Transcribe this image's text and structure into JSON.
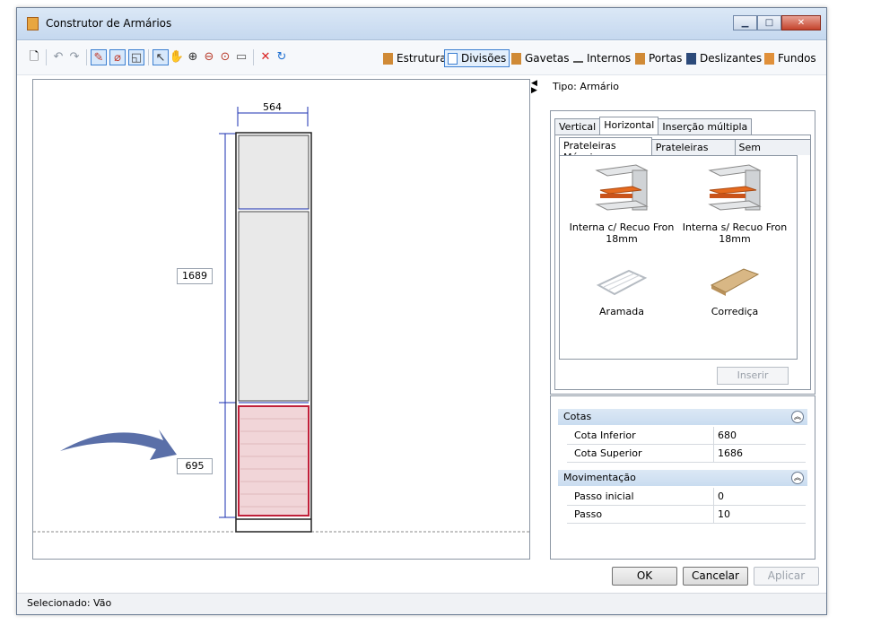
{
  "window": {
    "title": "Construtor de Armários",
    "minimize": "▁",
    "maximize": "□",
    "close": "✕"
  },
  "toolbar": {
    "left_icons": [
      "new-icon",
      "undo-icon",
      "redo-icon",
      "draw-icon",
      "edit-icon",
      "shape-icon",
      "select-icon",
      "pan-icon",
      "zoom-in-icon",
      "zoom-out-icon",
      "zoom-fit-icon",
      "window-icon",
      "delete-icon",
      "refresh-icon"
    ],
    "tabs": [
      {
        "label": "Estrutura",
        "icon": "estrutura-icon",
        "color": "#d08a36"
      },
      {
        "label": "Divisões",
        "icon": "divisoes-icon",
        "color": "#3c7fd1",
        "active": true
      },
      {
        "label": "Gavetas",
        "icon": "gavetas-icon",
        "color": "#d08a36"
      },
      {
        "label": "Internos",
        "icon": "internos-icon",
        "color": "#555555"
      },
      {
        "label": "Portas",
        "icon": "portas-icon",
        "color": "#d08a36"
      },
      {
        "label": "Deslizantes",
        "icon": "deslizantes-icon",
        "color": "#2c4a7a"
      },
      {
        "label": "Fundos",
        "icon": "fundos-icon",
        "color": "#e0903a"
      }
    ]
  },
  "drawing": {
    "width_label": "564",
    "height_label": "1689",
    "section_label": "695",
    "selected_color": "#c0203a",
    "dimension_color": "#1a2fb0"
  },
  "right_panel": {
    "tipo": "Tipo: Armário",
    "tabs": [
      "Vertical",
      "Horizontal",
      "Inserção múltipla"
    ],
    "subtabs": [
      "Prateleiras Móveis",
      "Prateleiras Fixas",
      "Sem Prateleira"
    ],
    "items": [
      {
        "label": "Interna c/ Recuo Fron 18mm"
      },
      {
        "label": "Interna s/ Recuo Fron 18mm"
      },
      {
        "label": "Aramada"
      },
      {
        "label": "Corrediça"
      }
    ],
    "insert_button": "Inserir"
  },
  "properties": {
    "groups": [
      {
        "title": "Cotas",
        "rows": [
          {
            "key": "Cota Inferior",
            "value": "680"
          },
          {
            "key": "Cota Superior",
            "value": "1686"
          }
        ]
      },
      {
        "title": "Movimentação",
        "rows": [
          {
            "key": "Passo inicial",
            "value": "0"
          },
          {
            "key": "Passo",
            "value": "10"
          }
        ]
      }
    ]
  },
  "buttons": {
    "ok": "OK",
    "cancel": "Cancelar",
    "apply": "Aplicar"
  },
  "status": "Selecionado: Vão"
}
